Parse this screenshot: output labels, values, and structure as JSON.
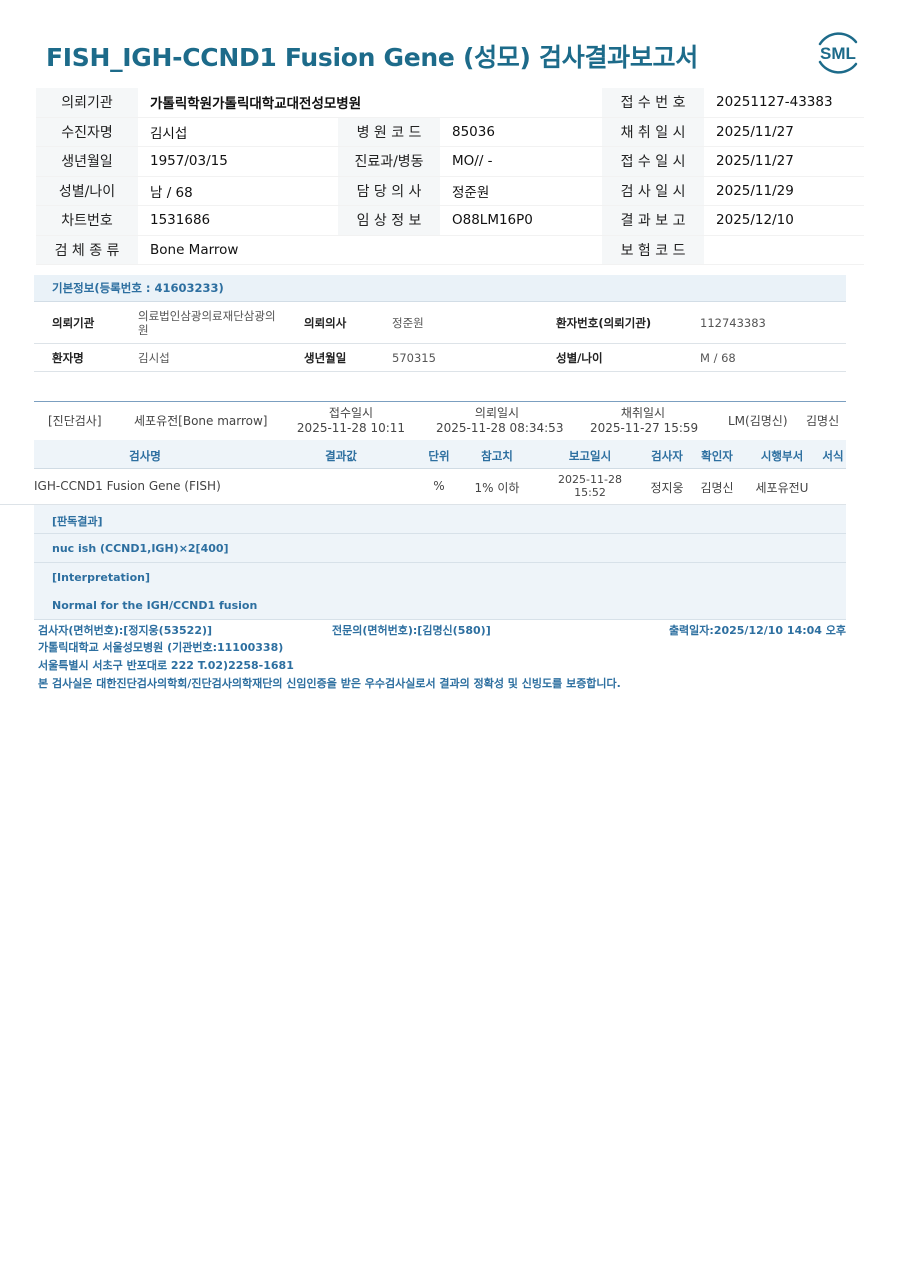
{
  "title": "FISH_IGH-CCND1 Fusion Gene (성모) 검사결과보고서",
  "logo": {
    "text": "SML",
    "color": "#1d6b8a"
  },
  "header": {
    "rows": [
      {
        "l1": "의뢰기관",
        "v1": "가톨릭학원가톨릭대학교대전성모병원",
        "l2": "",
        "v2": "",
        "l3": "접 수 번 호",
        "v3": "20251127-43383"
      },
      {
        "l1": "수진자명",
        "v1": "김시섭",
        "l2": "병 원 코 드",
        "v2": "85036",
        "l3": "채 취 일 시",
        "v3": "2025/11/27"
      },
      {
        "l1": "생년월일",
        "v1": "1957/03/15",
        "l2": "진료과/병동",
        "v2": "MO// -",
        "l3": "접 수 일 시",
        "v3": "2025/11/27"
      },
      {
        "l1": "성별/나이",
        "v1": "남 / 68",
        "l2": "담 당 의 사",
        "v2": "정준원",
        "l3": "검 사 일 시",
        "v3": "2025/11/29"
      },
      {
        "l1": "차트번호",
        "v1": "1531686",
        "l2": "임 상 정 보",
        "v2": "O88LM16P0",
        "l3": "결 과 보 고",
        "v3": "2025/12/10"
      },
      {
        "l1": "검 체 종 류",
        "v1": "Bone Marrow",
        "l2": "",
        "v2": "",
        "l3": "보 험 코 드",
        "v3": ""
      }
    ]
  },
  "basic": {
    "heading": "기본정보(등록번호 : 41603233)",
    "inst_label": "의뢰기관",
    "inst_value_1": "의료법인삼광의료재단삼광의",
    "inst_value_2": "원",
    "doctor_label": "의뢰의사",
    "doctor_value": "정준원",
    "patno_label": "환자번호(의뢰기관)",
    "patno_value": "112743383",
    "name_label": "환자명",
    "name_value": "김시섭",
    "dob_label": "생년월일",
    "dob_value": "570315",
    "sex_label": "성별/나이",
    "sex_value": "M / 68"
  },
  "exam": {
    "category": "[진단검사]",
    "specimen": "세포유전[Bone marrow]",
    "received_label": "접수일시",
    "received": "2025-11-28 10:11",
    "requested_label": "의뢰일시",
    "requested": "2025-11-28 08:34:53",
    "collected_label": "채취일시",
    "collected": "2025-11-27 15:59",
    "lm": "LM(김명신)",
    "signer": "김명신"
  },
  "columns": {
    "name": "검사명",
    "result": "결과값",
    "unit": "단위",
    "ref": "참고치",
    "report_date": "보고일시",
    "examiner": "검사자",
    "verifier": "확인자",
    "dept": "시행부서",
    "format": "서식"
  },
  "row": {
    "name": "IGH-CCND1 Fusion Gene (FISH)",
    "result": "",
    "unit": "%",
    "ref": "1% 이하",
    "report_date": "2025-11-28",
    "report_time": "15:52",
    "examiner": "정지웅",
    "verifier": "김명신",
    "dept": "세포유전U"
  },
  "interpretation": {
    "result_heading": "[판독결과]",
    "result_text": "nuc ish (CCND1,IGH)×2[400]",
    "interp_heading": "[Interpretation]",
    "interp_text": "Normal for the IGH/CCND1 fusion"
  },
  "footer": {
    "examiner": "검사자(면허번호):[정지웅(53522)]",
    "specialist": "전문의(면허번호):[김명신(580)]",
    "printed": "출력일자:2025/12/10 14:04 오후",
    "hospital": "가톨릭대학교 서울성모병원 (기관번호:11100338)",
    "address": "서울특별시 서초구 반포대로 222 T.02)2258-1681",
    "certification": "본 검사실은 대한진단검사의학회/진단검사의학재단의 신임인증을 받은 우수검사실로서 결과의 정확성 및 신빙도를 보증합니다."
  }
}
